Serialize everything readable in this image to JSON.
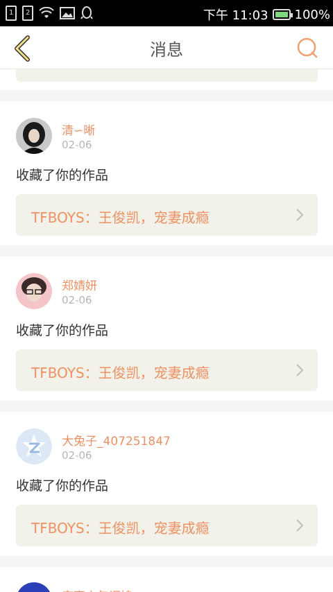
{
  "status_bar": {
    "sim1": "1",
    "sim2": "2",
    "time": "下午 11:03",
    "battery": "100%"
  },
  "header": {
    "title": "消息"
  },
  "messages": [
    {
      "username": "清∽晰",
      "date": "02-06",
      "action": "收藏了你的作品",
      "work_title": "TFBOYS：王俊凯，宠妻成瘾"
    },
    {
      "username": "郑婧妍",
      "date": "02-06",
      "action": "收藏了你的作品",
      "work_title": "TFBOYS：王俊凯，宠妻成瘾"
    },
    {
      "username": "大兔子_407251847",
      "date": "02-06",
      "action": "收藏了你的作品",
      "work_title": "TFBOYS：王俊凯，宠妻成瘾"
    },
    {
      "username": "宠妻少年调媳",
      "date": "",
      "action": "",
      "work_title": ""
    }
  ],
  "colors": {
    "accent": "#ef9062",
    "header_bg": "#ffffff",
    "link_bg": "#f3f2ea",
    "page_bg": "#f4f4f4"
  }
}
